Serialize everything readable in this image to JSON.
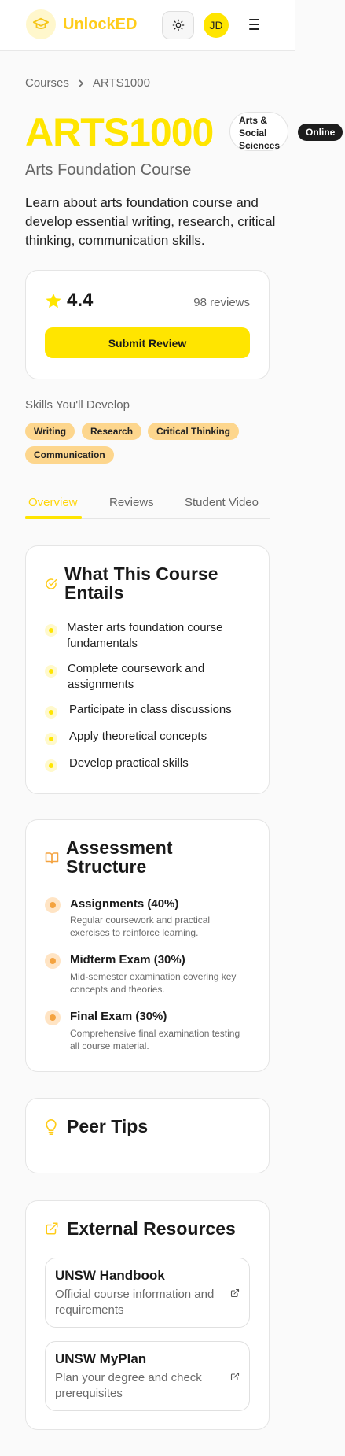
{
  "header": {
    "brand": "UnlockED",
    "avatar_initials": "JD",
    "icons": [
      "graduation-cap-icon",
      "sun-icon",
      "menu-icon"
    ]
  },
  "breadcrumb": {
    "root": "Courses",
    "current": "ARTS1000"
  },
  "course": {
    "code": "ARTS1000",
    "faculty": "Arts & Social Sciences",
    "mode": "Online",
    "title": "Arts Foundation Course",
    "description": "Learn about arts foundation course and develop essential writing, research, critical thinking, communication skills."
  },
  "rating": {
    "value": "4.4",
    "reviews": "98 reviews",
    "submit_label": "Submit Review"
  },
  "skills": {
    "title": "Skills You'll Develop",
    "items": [
      "Writing",
      "Research",
      "Critical Thinking",
      "Communication"
    ]
  },
  "tabs": [
    "Overview",
    "Reviews",
    "Student Video"
  ],
  "entails": {
    "title_line1": "What This Course",
    "title_line2": "Entails",
    "items": [
      "Master arts foundation course fundamentals",
      "Complete coursework and assignments",
      "Participate in class discussions",
      "Apply theoretical concepts",
      "Develop practical skills"
    ]
  },
  "assessment": {
    "title_line1": "Assessment",
    "title_line2": "Structure",
    "items": [
      {
        "title": "Assignments (40%)",
        "desc": "Regular coursework and practical exercises to reinforce learning."
      },
      {
        "title": "Midterm Exam (30%)",
        "desc": "Mid-semester examination covering key concepts and theories."
      },
      {
        "title": "Final Exam (30%)",
        "desc": "Comprehensive final examination testing all course material."
      }
    ]
  },
  "peer_tips": {
    "title": "Peer Tips"
  },
  "resources": {
    "title": "External Resources",
    "items": [
      {
        "title": "UNSW Handbook",
        "desc": "Official course information and requirements"
      },
      {
        "title": "UNSW MyPlan",
        "desc": "Plan your degree and check prerequisites"
      }
    ]
  },
  "colors": {
    "accent": "#ffe500",
    "brand_text": "#ffcc1a",
    "chip": "#fdd68d",
    "dark_badge": "#1d1d1d"
  }
}
